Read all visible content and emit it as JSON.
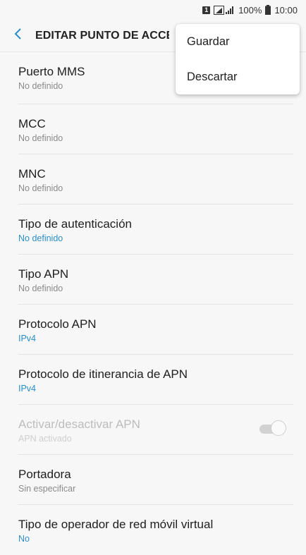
{
  "status_bar": {
    "sim_slot": "1",
    "battery_percent": "100%",
    "time": "10:00"
  },
  "appbar": {
    "title": "EDITAR PUNTO DE ACCESO"
  },
  "menu": {
    "items": [
      {
        "label": "Guardar"
      },
      {
        "label": "Descartar"
      }
    ]
  },
  "settings": [
    {
      "label": "Puerto MMS",
      "value": "No definido"
    },
    {
      "label": "MCC",
      "value": "No definido"
    },
    {
      "label": "MNC",
      "value": "No definido"
    },
    {
      "label": "Tipo de autenticación",
      "value": "No definido"
    },
    {
      "label": "Tipo APN",
      "value": "No definido"
    },
    {
      "label": "Protocolo APN",
      "value": "IPv4"
    },
    {
      "label": "Protocolo de itinerancia de APN",
      "value": "IPv4"
    },
    {
      "label": "Activar/desactivar APN",
      "value": "APN activado",
      "toggle_on": true,
      "disabled": true
    },
    {
      "label": "Portadora",
      "value": "Sin especificar"
    },
    {
      "label": "Tipo de operador de red móvil virtual",
      "value": "No"
    }
  ],
  "colors": {
    "accent": "#2a8fc7",
    "background": "#f7f7f7"
  },
  "icons": {
    "back": "chevron-left-icon",
    "signal": "signal-icon",
    "battery": "battery-icon"
  }
}
